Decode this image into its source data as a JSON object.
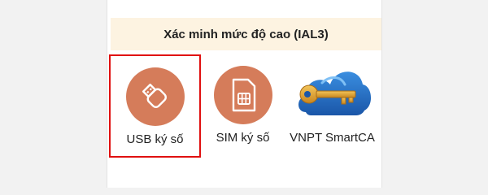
{
  "banner": {
    "title": "Xác minh mức độ cao (IAL3)"
  },
  "colors": {
    "circle": "#d57c5a",
    "banner_bg": "#fdf3e1",
    "selection_border": "#e01010",
    "cloud_blue": "#1f63b5",
    "key_gold": "#e0a033"
  },
  "options": [
    {
      "label": "USB ký số",
      "icon": "usb-drive-icon",
      "selected": true
    },
    {
      "label": "SIM ký số",
      "icon": "sim-card-icon",
      "selected": false
    },
    {
      "label": "VNPT SmartCA",
      "icon": "cloud-key-logo",
      "selected": false
    }
  ]
}
